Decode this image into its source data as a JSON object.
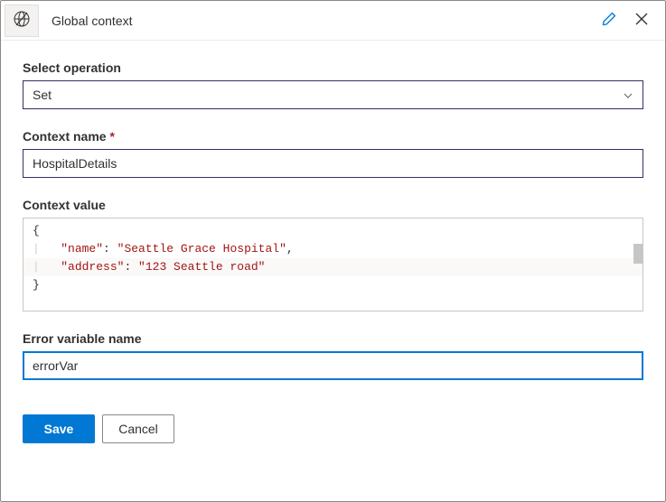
{
  "header": {
    "title": "Global context"
  },
  "fields": {
    "selectOperation": {
      "label": "Select operation",
      "value": "Set"
    },
    "contextName": {
      "label": "Context name",
      "value": "HospitalDetails",
      "required": true
    },
    "contextValue": {
      "label": "Context value",
      "code": {
        "line1_key": "\"name\"",
        "line1_val": "\"Seattle Grace Hospital\"",
        "line2_key": "\"address\"",
        "line2_val": "\"123 Seattle road\""
      }
    },
    "errorVariableName": {
      "label": "Error variable name",
      "value": "errorVar"
    }
  },
  "buttons": {
    "save": "Save",
    "cancel": "Cancel"
  }
}
